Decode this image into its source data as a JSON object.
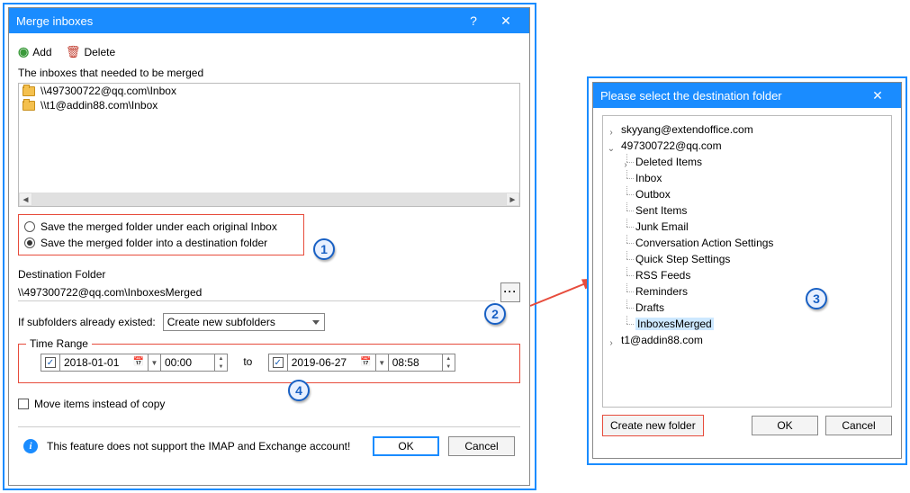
{
  "main": {
    "title": "Merge inboxes",
    "toolbar": {
      "add": "Add",
      "delete": "Delete"
    },
    "list_label": "The inboxes that needed to be merged",
    "inboxes": [
      "\\\\497300722@qq.com\\Inbox",
      "\\\\t1@addin88.com\\Inbox"
    ],
    "radios": {
      "opt1": "Save the merged folder under each original Inbox",
      "opt2": "Save the merged folder into a destination folder"
    },
    "dest_label": "Destination Folder",
    "dest_value": "\\\\497300722@qq.com\\InboxesMerged",
    "subfolders_label": "If subfolders already existed:",
    "subfolders_combo": "Create new subfolders",
    "timerange": {
      "legend": "Time Range",
      "from_date": "2018-01-01",
      "from_time": "00:00",
      "to_label": "to",
      "to_date": "2019-06-27",
      "to_time": "08:58"
    },
    "move_label": "Move items instead of copy",
    "info_text": "This feature does not support the IMAP and Exchange account!",
    "ok": "OK",
    "cancel": "Cancel"
  },
  "picker": {
    "title": "Please select the destination folder",
    "tree": {
      "acc1": "skyyang@extendoffice.com",
      "acc2": "497300722@qq.com",
      "acc2_children": [
        "Deleted Items",
        "Inbox",
        "Outbox",
        "Sent Items",
        "Junk Email",
        "Conversation Action Settings",
        "Quick Step Settings",
        "RSS Feeds",
        "Reminders",
        "Drafts",
        "InboxesMerged"
      ],
      "acc3": "t1@addin88.com"
    },
    "create": "Create new folder",
    "ok": "OK",
    "cancel": "Cancel"
  },
  "callouts": {
    "c1": "1",
    "c2": "2",
    "c3": "3",
    "c4": "4"
  }
}
